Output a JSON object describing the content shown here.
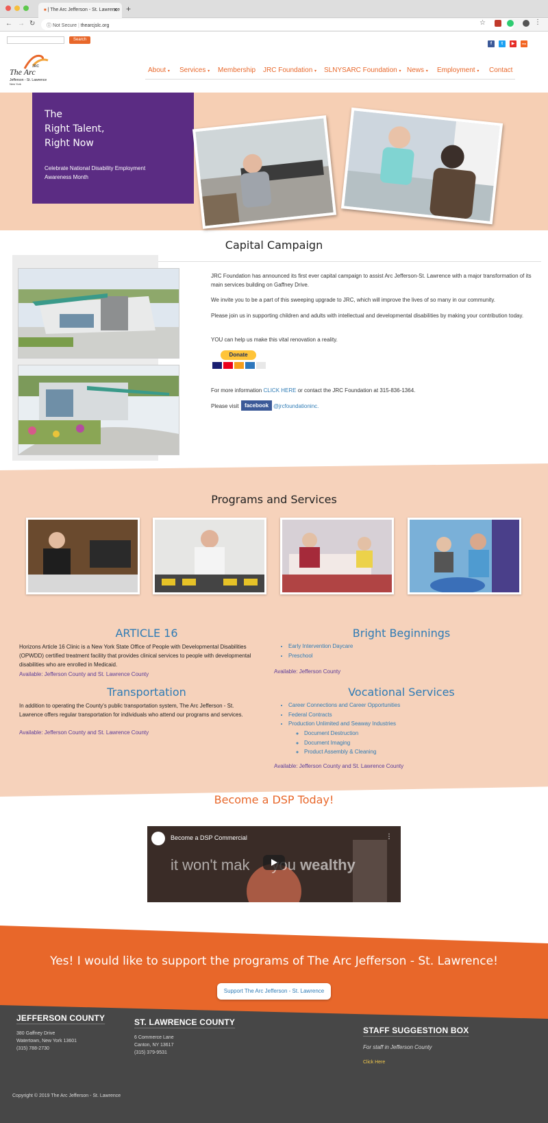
{
  "browser": {
    "tab_title": "| The Arc Jefferson - St. Lawrence",
    "not_secure": "Not Secure",
    "url": "thearcjslc.org"
  },
  "topbar": {
    "search_button": "Search",
    "social": [
      "f",
      "t",
      "▶",
      "rss"
    ]
  },
  "header": {
    "logo_name": "The Arc",
    "logo_sub1": "Jefferson - St. Lawrence",
    "logo_sub2": "New York",
    "logo_mark": "JRC",
    "nav": [
      {
        "label": "About",
        "dropdown": true
      },
      {
        "label": "Services",
        "dropdown": true
      },
      {
        "label": "Membership",
        "dropdown": false
      },
      {
        "label": "JRC Foundation",
        "dropdown": true
      },
      {
        "label": "SLNYSARC Foundation",
        "dropdown": true
      },
      {
        "label": "News",
        "dropdown": true
      },
      {
        "label": "Employment",
        "dropdown": true
      },
      {
        "label": "Contact",
        "dropdown": false
      }
    ]
  },
  "hero": {
    "line1": "The",
    "line2": "Right Talent,",
    "line3": "Right Now",
    "subtitle": "Celebrate National Disability Employment Awareness Month"
  },
  "capital": {
    "title": "Capital Campaign",
    "p1": "JRC Foundation has announced its first ever capital campaign to assist Arc Jefferson-St. Lawrence with a major transformation of its main services building on Gaffney Drive.",
    "p2": "We invite you to be a part of this sweeping upgrade to JRC, which will improve the lives of so many in our community.",
    "p3": "Please join us in supporting children and adults with intellectual and developmental disabilities by making your contribution today.",
    "p4": "YOU can help us make this vital renovation a reality.",
    "donate": "Donate",
    "info_prefix": "For more information ",
    "click_here": "CLICK HERE",
    "info_suffix": " or contact the JRC Foundation at 315-836-1364.",
    "visit": "Please visit",
    "facebook": "facebook",
    "fb_handle": "@jrcfoundationinc."
  },
  "programs": {
    "title": "Programs and Services",
    "article16": {
      "title": "ARTICLE 16",
      "text": "Horizons Article 16 Clinic is a New York State Office of People with Developmental Disabilities (OPWDD) certified treatment facility that provides clinical services to people with developmental disabilities who are enrolled in Medicaid.",
      "avail": "Available: Jefferson County and St. Lawrence County"
    },
    "bright": {
      "title": "Bright Beginnings",
      "items": [
        "Early Intervention Daycare",
        "Preschool"
      ],
      "avail": "Available: Jefferson County"
    },
    "transport": {
      "title": "Transportation",
      "text": "In addition to operating the County's public transportation system, The Arc Jefferson - St. Lawrence offers regular transportation for individuals who attend our programs and services.",
      "avail": "Available: Jefferson County and St. Lawrence County"
    },
    "vocational": {
      "title": "Vocational Services",
      "items": [
        "Career Connections and Career Opportunities",
        "Federal Contracts",
        "Production Unlimited and Seaway Industries"
      ],
      "subitems": [
        "Document Destruction",
        "Document Imaging",
        "Product Assembly & Cleaning"
      ],
      "avail": "Available: Jefferson County and St. Lawrence County"
    }
  },
  "dsp": {
    "title": "Become a DSP Today!",
    "video_title": "Become a DSP Commercial",
    "video_caption_a": "it won't mak",
    "video_caption_b": "you ",
    "video_caption_c": "wealthy"
  },
  "support": {
    "text": "Yes! I would like to support the programs of The Arc Jefferson - St. Lawrence!",
    "button": "Support The Arc Jefferson - St. Lawrence"
  },
  "footer": {
    "jefferson": {
      "title": "JEFFERSON COUNTY",
      "l1": "380 Gaffney Drive",
      "l2": "Watertown, New York 13601",
      "l3": "(315) 788-2730"
    },
    "stlawrence": {
      "title": "ST. LAWRENCE COUNTY",
      "l1": "6 Commerce Lane",
      "l2": "Canton, NY 13617",
      "l3": "(315) 379-9531"
    },
    "staff": {
      "title": "STAFF SUGGESTION BOX",
      "sub": "For staff in Jefferson County",
      "link": "Click Here"
    },
    "copyright": "Copyright © 2019 The Arc Jefferson - St. Lawrence"
  },
  "colors": {
    "accent": "#e8672a",
    "purple": "#5b2c83",
    "peach": "#f6cfb4",
    "link": "#2e7bb5",
    "footer": "#474747"
  }
}
